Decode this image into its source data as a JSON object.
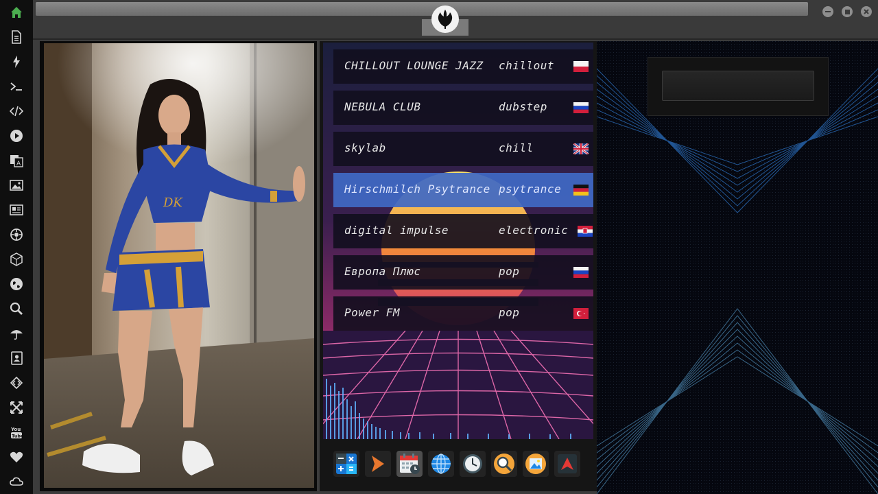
{
  "stations": [
    {
      "name": "CHILLOUT LOUNGE JAZZ",
      "genre": "chillout",
      "flag": "pl-flag-icon",
      "active": false
    },
    {
      "name": "NEBULA CLUB",
      "genre": "dubstep",
      "flag": "ru-flag-icon",
      "active": false
    },
    {
      "name": "skylab",
      "genre": "chill",
      "flag": "gb-flag-icon",
      "active": false
    },
    {
      "name": "Hirschmilch Psytrance",
      "genre": "psytrance",
      "flag": "de-flag-icon",
      "active": true
    },
    {
      "name": "digital impulse",
      "genre": "electronic",
      "flag": "hr-flag-icon",
      "active": false
    },
    {
      "name": "Европа Плюс",
      "genre": "pop",
      "flag": "ru-flag-icon",
      "active": false
    },
    {
      "name": "Power FM",
      "genre": "pop",
      "flag": "tr-flag-icon",
      "active": false
    }
  ],
  "sidebar": [
    "home-icon",
    "document-icon",
    "bolt-icon",
    "terminal-icon",
    "code-icon",
    "play-icon",
    "translate-icon",
    "image-icon",
    "news-icon",
    "settings-icon",
    "cube-icon",
    "globe-icon",
    "search-icon",
    "umbrella-icon",
    "contacts-icon",
    "code-brackets-icon",
    "fullscreen-icon",
    "youtube-icon",
    "heart-icon",
    "cloud-icon"
  ],
  "dock": [
    "calculator-icon",
    "terminal-arrow-icon",
    "calendar-icon",
    "globe-icon",
    "clock-icon",
    "search-icon",
    "image-viewer-icon",
    "arrow-up-icon"
  ],
  "colors": {
    "accent": "#4068c4",
    "home": "#4caf50",
    "sidebar_icon": "#d6d6d6"
  }
}
